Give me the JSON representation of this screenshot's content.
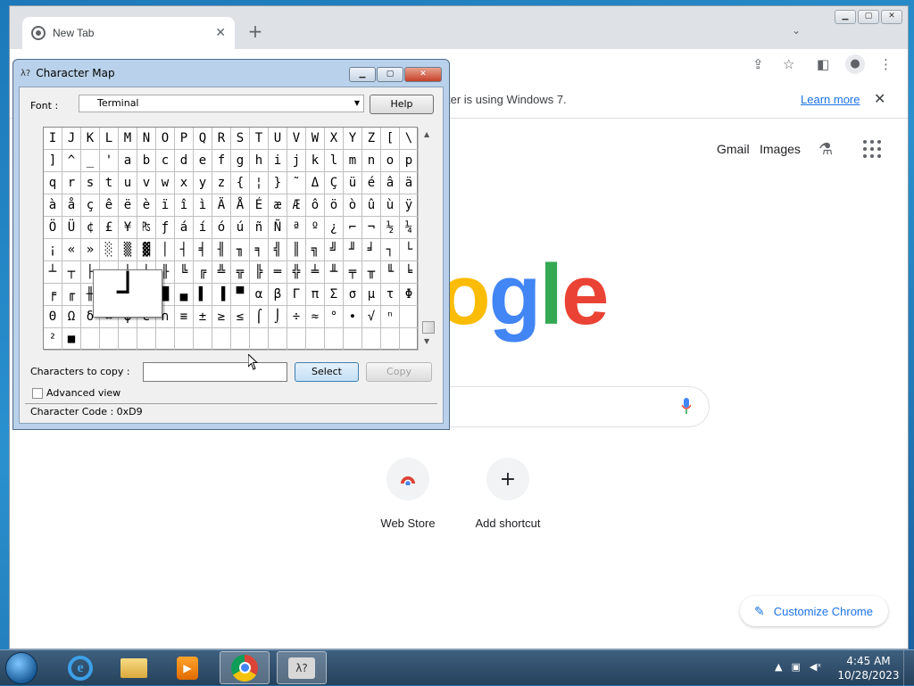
{
  "chrome": {
    "tab_title": "New Tab",
    "tab_close": "✕",
    "new_tab": "+",
    "tab_search": "⌄",
    "infobar_text": "ter is using Windows 7.",
    "infobar_link": "Learn more",
    "infobar_close": "✕",
    "page": {
      "gmail": "Gmail",
      "images": "Images",
      "logo_o": "o",
      "logo_g": "g",
      "logo_l": "l",
      "logo_e": "e",
      "shortcuts": [
        {
          "label": "Web Store"
        },
        {
          "label": "Add shortcut",
          "glyph": "+"
        }
      ],
      "customize": "Customize Chrome"
    }
  },
  "charmap": {
    "title": "Character Map",
    "font_label": "Font :",
    "font_value": "Terminal",
    "help_button": "Help",
    "characters": [
      "I",
      "J",
      "K",
      "L",
      "M",
      "N",
      "O",
      "P",
      "Q",
      "R",
      "S",
      "T",
      "U",
      "V",
      "W",
      "X",
      "Y",
      "Z",
      "[",
      "\\",
      "]",
      "^",
      "_",
      "'",
      "a",
      "b",
      "c",
      "d",
      "e",
      "f",
      "g",
      "h",
      "i",
      "j",
      "k",
      "l",
      "m",
      "n",
      "o",
      "p",
      "q",
      "r",
      "s",
      "t",
      "u",
      "v",
      "w",
      "x",
      "y",
      "z",
      "{",
      "¦",
      "}",
      "˜",
      "Δ",
      "Ç",
      "ü",
      "é",
      "â",
      "ä",
      "à",
      "å",
      "ç",
      "ê",
      "ë",
      "è",
      "ï",
      "î",
      "ì",
      "Ä",
      "Å",
      "É",
      "æ",
      "Æ",
      "ô",
      "ö",
      "ò",
      "û",
      "ù",
      "ÿ",
      "Ö",
      "Ü",
      "¢",
      "£",
      "¥",
      "₧",
      "ƒ",
      "á",
      "í",
      "ó",
      "ú",
      "ñ",
      "Ñ",
      "ª",
      "º",
      "¿",
      "⌐",
      "¬",
      "½",
      "¼",
      "¡",
      "«",
      "»",
      "░",
      "▒",
      "▓",
      "│",
      "┤",
      "╡",
      "╢",
      "╖",
      "╕",
      "╣",
      "║",
      "╗",
      "╝",
      "╜",
      "╛",
      "┐",
      "└",
      "┴",
      "┬",
      "├",
      "─",
      "┼",
      "╞",
      "╟",
      "╚",
      "╔",
      "╩",
      "╦",
      "╠",
      "═",
      "╬",
      "╧",
      "╨",
      "╤",
      "╥",
      "╙",
      "╘",
      "╒",
      "╓",
      "╫",
      "╪",
      "┘",
      "┌",
      "█",
      "▄",
      "▌",
      "▐",
      "▀",
      "α",
      "β",
      "Γ",
      "π",
      "Σ",
      "σ",
      "µ",
      "τ",
      "Φ",
      "Θ",
      "Ω",
      "δ",
      "∞",
      "φ",
      "ε",
      "∩",
      "≡",
      "±",
      "≥",
      "≤",
      "⌠",
      "⌡",
      "÷",
      "≈",
      "°",
      "∙",
      "√",
      "ⁿ",
      "",
      "²",
      "■",
      "",
      "",
      "",
      "",
      "",
      "",
      "",
      "",
      "",
      "",
      "",
      "",
      "",
      "",
      "",
      "",
      "",
      ""
    ],
    "zoom_char": "┘",
    "copy_label": "Characters to copy :",
    "copy_value": "",
    "select_button": "Select",
    "copy_button": "Copy",
    "advanced_label": "Advanced view",
    "status": "Character Code : 0xD9"
  },
  "taskbar": {
    "media_glyph": "▶",
    "cmap_glyph": "λ?",
    "time": "4:45 AM",
    "date": "10/28/2023"
  }
}
